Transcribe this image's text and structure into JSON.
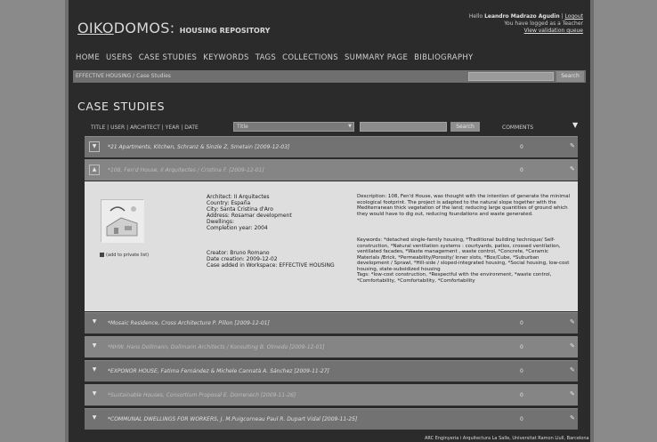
{
  "header": {
    "logo_oiko": "OIKO",
    "logo_rest": "DOMOS:",
    "logo_sub": "HOUSING REPOSITORY",
    "hello_prefix": "Hello",
    "user_name": "Leandro Madrazo Agudin",
    "logout": "Logout",
    "logged_as": "You have logged as a Teacher",
    "validation_queue": "View validation queue"
  },
  "nav": {
    "items": [
      "HOME",
      "USERS",
      "CASE STUDIES",
      "KEYWORDS",
      "TAGS",
      "COLLECTIONS",
      "SUMMARY PAGE",
      "BIBLIOGRAPHY"
    ]
  },
  "crumbbar": {
    "breadcrumb": "EFFECTIVE HOUSING / Case Studies",
    "search_button": "Search"
  },
  "page_title": "CASE STUDIES",
  "filters": {
    "sort_options": "TITLE | USER | ARCHITECT | YEAR | DATE",
    "select_value": "Title",
    "search_button": "Search",
    "comments_label": "COMMENTS"
  },
  "rows": [
    {
      "label": "*21 Apartments, Kitchen, Schranz & Sinzle Z, Smetain [2009-12-03]",
      "count": "0"
    },
    {
      "label": "*108, Fen'd House, II Arquitectes / Cristina F. [2009-12-01]",
      "count": "0"
    },
    {
      "label": "*Mosaic Residence, Cross Architecture P. Pillon [2009-12-01]",
      "count": "0"
    },
    {
      "label": "*NHW, Hans Dollmann, Dollmann Architects / Konsulting B. Olmedo [2009-12-01]",
      "count": "0"
    },
    {
      "label": "*EXPONOR HOUSE, Fatima Fernández & Michele Cannatà A. Sánchez [2009-11-27]",
      "count": "0"
    },
    {
      "label": "*Sustainable Houses, Consortium Proposal E. Domenech [2009-11-26]",
      "count": "0"
    },
    {
      "label": "*COMMUNAL DWELLINGS FOR WORKERS, J. M.Puigcorneau Paul R. Dupart Vidal [2009-11-25]",
      "count": "0"
    }
  ],
  "detail": {
    "add_private": "(add to private list)",
    "architect": "Architect: II Arquitectes",
    "country": "Country: España",
    "city": "City: Santa Cristina d'Aro",
    "address": "Address: Rosamar development",
    "dwellings": "Dwellings:",
    "completion": "Completion year: 2004",
    "creator": "Creator: Bruno Romano",
    "date_creation": "Date creation: 2009-12-02",
    "case_added": "Case added in Workspace: EFFECTIVE HOUSING",
    "description": "Description: 108, Fen'd House, was thought with the intention of generate the minimal ecological footprint. The project is adapted to the natural slope together with the Mediterranean thick vegetation of the land; reducing large quantities of ground which they would have to dig out, reducing foundations and waste generated.",
    "keywords": "Keywords: *detached single-family housing, *Traditional building technique/ Self-construction, *Natural ventilation systems : courtyards, patios, crossed ventilation, ventilated facades, *Waste management , waste control, *Concrete, *Ceramic Materials /Brick, *Permeability/Porosity/ Inner slots, *Box/Cube, *Suburban development / Sprawl, *Hill-side / sloped-integrated housing, *Social housing, low-cost housing, state-subsidized housing",
    "tags": "Tags: *low-cost construction, *Respectful with the environment, *waste control, *Comfortability, *Comfortability, *Comfortability"
  },
  "footer": "ARC Enginyeria i Arquitectura La Salle, Universitat Ramon Llull, Barcelona"
}
